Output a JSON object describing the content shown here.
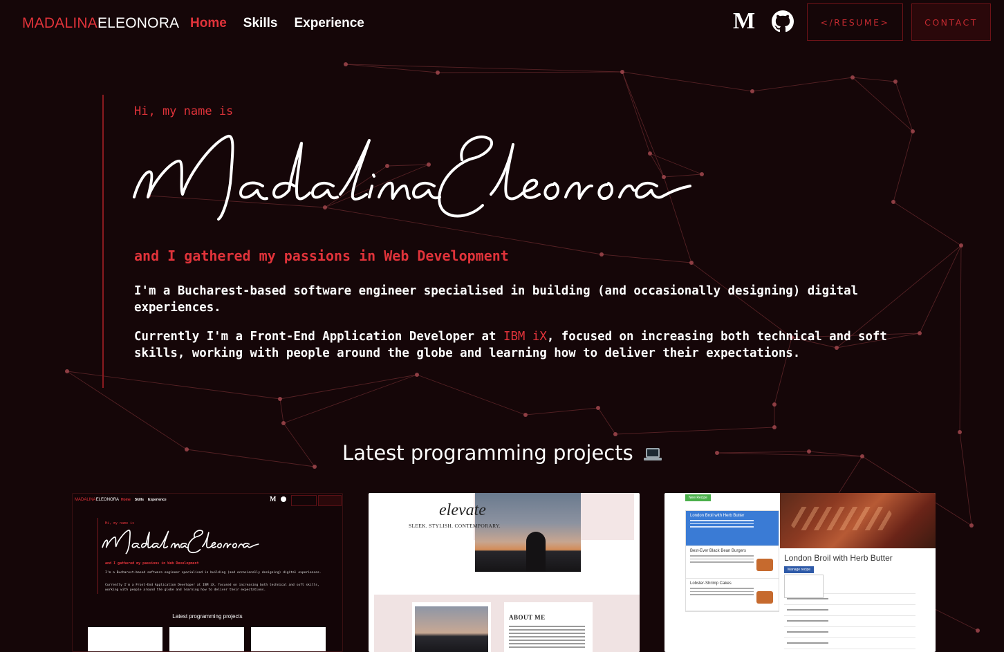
{
  "header": {
    "brand_first": "MADALINA",
    "brand_last": "ELEONORA",
    "nav": [
      {
        "label": "Home",
        "active": true
      },
      {
        "label": "Skills",
        "active": false
      },
      {
        "label": "Experience",
        "active": false
      }
    ],
    "medium_glyph": "M",
    "resume_label": "</RESUME>",
    "contact_label": "CONTACT"
  },
  "hero": {
    "greeting": "Hi, my name is",
    "signature": "Madalina Eleonora",
    "tagline": "and I gathered my passions in Web Development",
    "bio_1": "I'm a Bucharest-based software engineer specialised in building (and occasionally designing) digital experiences.",
    "bio_2_prefix": "Currently I'm a Front-End Application Developer at ",
    "bio_2_company": "IBM iX",
    "bio_2_suffix": ", focused on increasing both technical and soft skills, working with people around the globe and learning how to deliver their expectations."
  },
  "projects": {
    "title": "Latest programming projects",
    "title_icon": "laptop-icon",
    "cards": [
      {
        "preview": "portfolio",
        "brand_first": "MADALINA",
        "brand_last": "ELEONORA",
        "nav": [
          "Home",
          "Skills",
          "Experience"
        ],
        "greeting": "Hi, my name is",
        "tagline": "and I gathered my passions in Web Development",
        "bio_1": "I'm a Bucharest-based software engineer specialised in building (and occasionally designing) digital experiences.",
        "bio_2": "Currently I'm a Front-End Application Developer at IBM iX, focused on increasing both technical and soft skills, working with people around the globe and learning how to deliver their expectations.",
        "section_title": "Latest programming projects"
      },
      {
        "preview": "elevate",
        "logo": "elevate",
        "tagline": "SLEEK. STYLISH. CONTEMPORARY.",
        "about": "ABOUT ME"
      },
      {
        "preview": "recipes",
        "new_button": "New Recipe",
        "items": [
          "London Broil with Herb Butter",
          "Best-Ever Black Bean Burgers",
          "Lobster-Shrimp Cakes"
        ],
        "detail_title": "London Broil with Herb Butter",
        "manage_button": "Manage recipe"
      }
    ]
  },
  "colors": {
    "background": "#150608",
    "accent": "#e0333a",
    "border": "#6e1318",
    "network_line": "#6a2a2e",
    "network_node": "#a0474c"
  }
}
